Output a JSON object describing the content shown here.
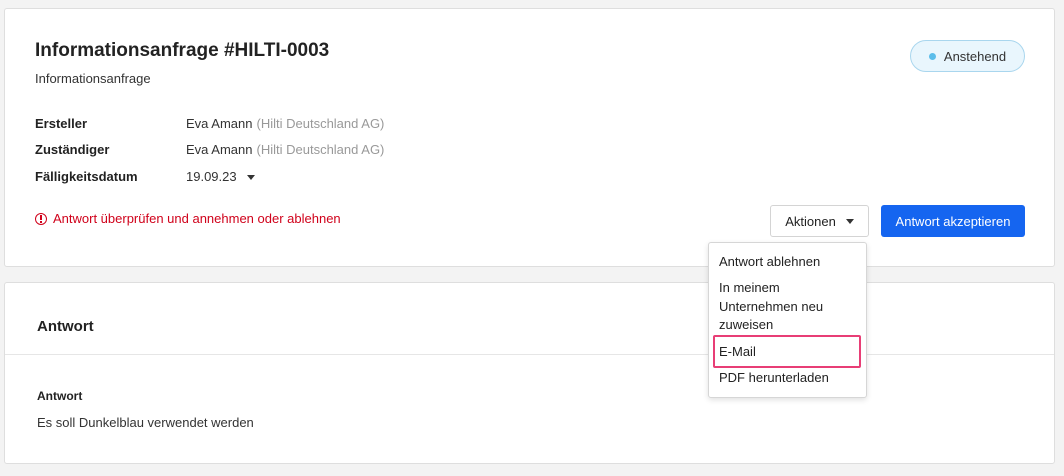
{
  "request": {
    "title": "Informationsanfrage #HILTI-0003",
    "subtitle": "Informationsanfrage",
    "status": "Anstehend",
    "creator_label": "Ersteller",
    "creator_name": "Eva Amann",
    "creator_company": "(Hilti Deutschland AG)",
    "assignee_label": "Zuständiger",
    "assignee_name": "Eva Amann",
    "assignee_company": "(Hilti Deutschland AG)",
    "due_label": "Fälligkeitsdatum",
    "due_value": "19.09.23",
    "warning": "Antwort überprüfen und annehmen oder ablehnen"
  },
  "actions": {
    "actions_label": "Aktionen",
    "accept_label": "Antwort akzeptieren",
    "menu": [
      "Antwort ablehnen",
      "In meinem Unternehmen neu zuweisen",
      "E-Mail",
      "PDF herunterladen"
    ],
    "highlighted_item": "E-Mail"
  },
  "answer": {
    "section_title": "Antwort",
    "label": "Antwort",
    "text": "Es soll Dunkelblau verwendet werden"
  },
  "colors": {
    "primary": "#1565f0",
    "warning": "#d0021b",
    "status_dot": "#5bbdea",
    "highlight": "#e83e76"
  }
}
